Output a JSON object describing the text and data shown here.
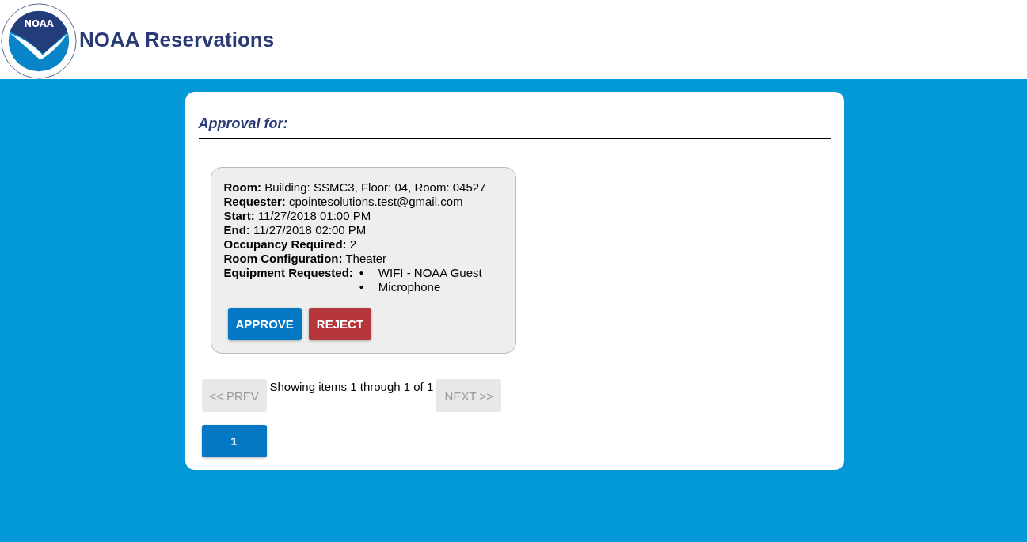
{
  "header": {
    "logo": {
      "letters": "NOAA"
    },
    "title": "NOAA Reservations"
  },
  "section_title": "Approval for:",
  "requests": [
    {
      "fields": [
        {
          "label": "Room:",
          "value": "Building: SSMC3, Floor: 04, Room: 04527"
        },
        {
          "label": "Requester:",
          "value": "cpointesolutions.test@gmail.com"
        },
        {
          "label": "Start:",
          "value": "11/27/2018 01:00 PM"
        },
        {
          "label": "End:",
          "value": "11/27/2018 02:00 PM"
        },
        {
          "label": "Occupancy Required:",
          "value": "2"
        },
        {
          "label": "Room Configuration:",
          "value": "Theater"
        }
      ],
      "equipment": {
        "label": "Equipment Requested:",
        "items": [
          {
            "marker": "•",
            "text": "WIFI - NOAA Guest"
          },
          {
            "marker": "•",
            "text": "Microphone"
          }
        ]
      },
      "actions": [
        {
          "label": "APPROVE",
          "kind": "approve"
        },
        {
          "label": "REJECT",
          "kind": "reject"
        }
      ]
    }
  ],
  "pagination": {
    "prev": {
      "label": "<< PREV",
      "disabled": true
    },
    "summary": "Showing items 1 through 1 of 1",
    "next": {
      "label": "NEXT >>",
      "disabled": true
    },
    "pages": [
      {
        "label": "1",
        "selected": true
      }
    ]
  }
}
